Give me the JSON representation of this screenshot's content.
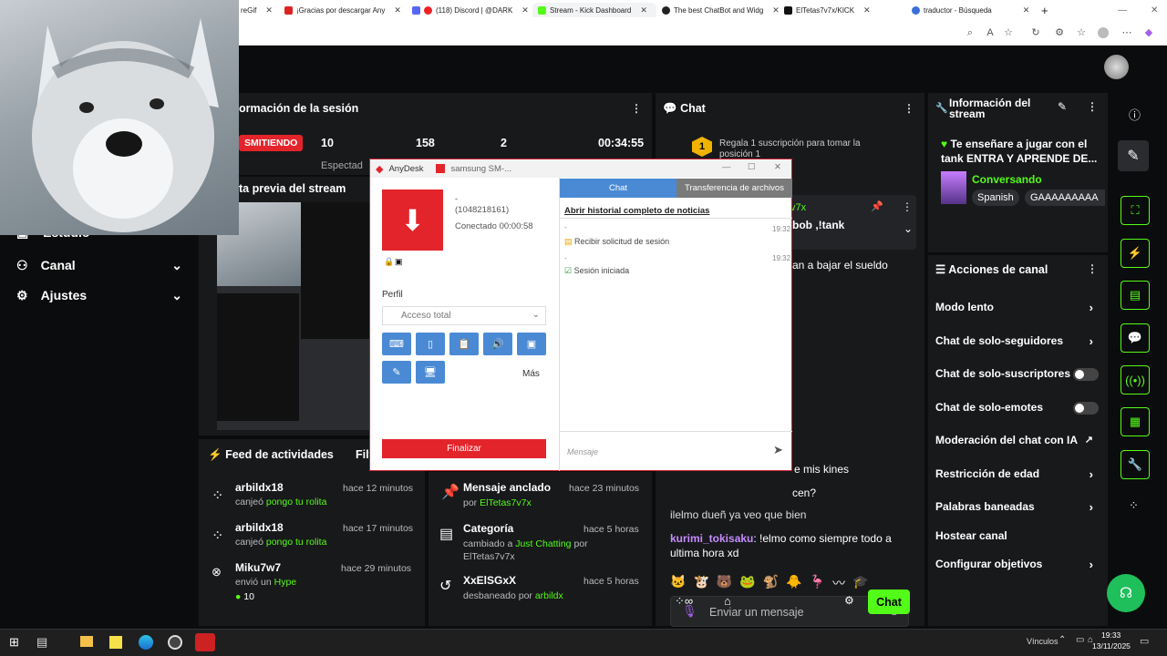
{
  "browser": {
    "tabs": [
      {
        "label": "reGif",
        "favicon_color": "#e24"
      },
      {
        "label": "¡Gracias por descargar Any",
        "favicon_color": "#d22"
      },
      {
        "label": "(118) Discord | @DARK",
        "favicon_color": "#5865f2"
      },
      {
        "label": "Stream - Kick Dashboard",
        "favicon_color": "#53fc18"
      },
      {
        "label": "The best ChatBot and Widg",
        "favicon_color": "#222"
      },
      {
        "label": "ElTetas7v7x/KICK",
        "favicon_color": "#111"
      },
      {
        "label": "traductor - Búsqueda",
        "favicon_color": "#3b6fd6"
      }
    ]
  },
  "sidebar": {
    "items": [
      {
        "label": "Estudio",
        "icon": "studio-icon"
      },
      {
        "label": "Canal",
        "icon": "users-icon"
      },
      {
        "label": "Ajustes",
        "icon": "gear-icon"
      }
    ]
  },
  "session": {
    "title": "ormación de la sesión",
    "live_badge": "SMITIENDO",
    "stats": [
      "10",
      "158",
      "2",
      "00:34:55"
    ],
    "spectators_label": "Espectad"
  },
  "preview": {
    "title": "ta previa del stream"
  },
  "feed": {
    "title": "Feed de actividades",
    "filter": "Filt",
    "items": [
      {
        "user": "arbildx18",
        "time": "hace 12 minutos",
        "action": "canjeó",
        "detail": "pongo tu rolita"
      },
      {
        "user": "arbildx18",
        "time": "hace 17 minutos",
        "action": "canjeó",
        "detail": "pongo tu rolita"
      },
      {
        "user": "Miku7w7",
        "time": "hace 29 minutos",
        "action": "envió un",
        "detail": "Hype",
        "amount": "10"
      }
    ]
  },
  "mod_feed": {
    "items": [
      {
        "title": "Mensaje anclado",
        "time": "hace 23 minutos",
        "line": "por",
        "who": "ElTetas7v7x"
      },
      {
        "title": "Categoría",
        "time": "hace 5 horas",
        "line": "cambiado a",
        "who": "Just Chatting",
        "line2": "por",
        "who2": "ElTetas7v7x"
      },
      {
        "title": "XxElSGxX",
        "time": "hace 5 horas",
        "line": "desbaneado por",
        "who": "arbildx"
      }
    ]
  },
  "chat": {
    "title": "Chat",
    "gift_text": "Regala 1 suscripción para tomar la posición 1",
    "gift_rank": "1",
    "pinned_fragment": "bob ,!tank",
    "pinned_user": "v7x",
    "fragments": [
      "an a bajar el sueldo",
      "e mis kines",
      "cen?",
      "ilelmo dueñ ya veo que bien"
    ],
    "last_msg_user": "kurimi_tokisaku",
    "last_msg_text": ": !elmo como siempre todo a ultima hora xd",
    "input_placeholder": "Enviar un mensaje",
    "send_label": "Chat"
  },
  "stream_info": {
    "title": "Información del stream",
    "stream_title": "Te enseñare a jugar con el tank ENTRA Y APRENDE DE...",
    "category": "Conversando",
    "tags": [
      "Spanish",
      "GAAAAAAAAA"
    ]
  },
  "channel_actions": {
    "title": "Acciones de canal",
    "items": [
      {
        "label": "Modo lento",
        "control": "chevron"
      },
      {
        "label": "Chat de solo-seguidores",
        "control": "chevron"
      },
      {
        "label": "Chat de solo-suscriptores",
        "control": "toggle"
      },
      {
        "label": "Chat de solo-emotes",
        "control": "toggle"
      },
      {
        "label": "Moderación del chat con IA",
        "control": "external"
      },
      {
        "label": "Restricción de edad",
        "control": "chevron"
      },
      {
        "label": "Palabras baneadas",
        "control": "chevron"
      },
      {
        "label": "Hostear canal",
        "control": "none"
      },
      {
        "label": "Configurar objetivos",
        "control": "chevron"
      }
    ]
  },
  "anydesk": {
    "app_name": "AnyDesk",
    "tab_name": "samsung SM-...",
    "remote_alias": "-",
    "remote_id": "(1048218161)",
    "status": "Conectado 00:00:58",
    "profile_label": "Perfil",
    "profile_value": "Acceso total",
    "more_label": "Más",
    "finish_label": "Finalizar",
    "tab_chat": "Chat",
    "tab_files": "Transferencia de archivos",
    "history_link": "Abrir historial completo de noticias",
    "events": [
      {
        "time": "19:32",
        "sender": "-",
        "text": "Recibir solicitud de sesión"
      },
      {
        "time": "19:32",
        "sender": "-",
        "text": "Sesión iniciada"
      }
    ],
    "message_placeholder": "Mensaje"
  },
  "taskbar": {
    "tray_label": "Vínculos",
    "time": "19:33",
    "date": "13/11/2025"
  },
  "colors": {
    "kick_green": "#53fc18",
    "anydesk_red": "#e3242b",
    "anydesk_blue": "#4a8ad4",
    "panel": "#18191b"
  }
}
